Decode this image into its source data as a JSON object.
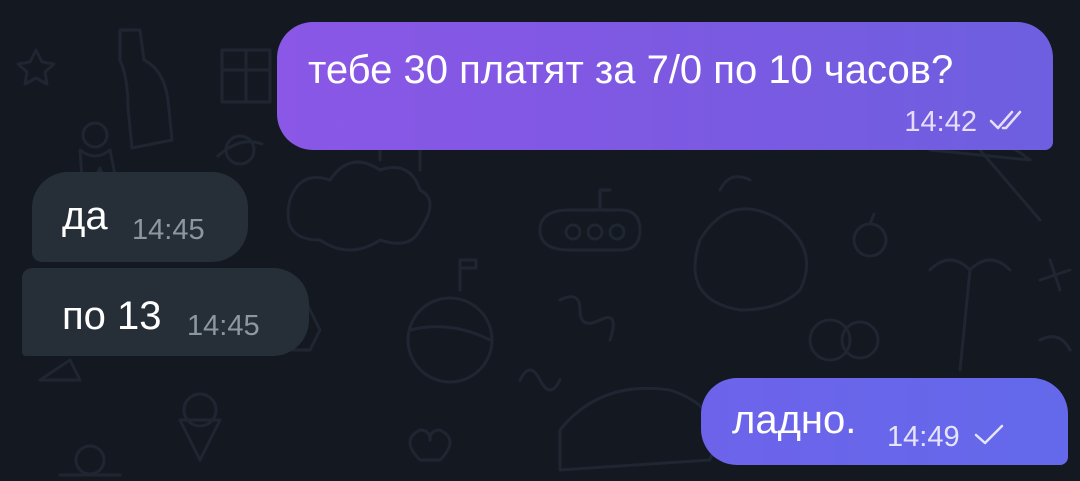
{
  "chat": {
    "background_color": "#141821",
    "messages": [
      {
        "id": "out-1",
        "direction": "outgoing",
        "text": "тебе 30 платят за 7/0 по 10 часов?",
        "time": "14:42",
        "status_icon": "double-check-icon"
      },
      {
        "id": "in-1",
        "direction": "incoming",
        "text": "да",
        "time": "14:45"
      },
      {
        "id": "in-2",
        "direction": "incoming",
        "text": "по 13",
        "time": "14:45"
      },
      {
        "id": "out-2",
        "direction": "outgoing",
        "text": "ладно.",
        "time": "14:49",
        "status_icon": "single-check-icon"
      }
    ]
  },
  "colors": {
    "outgoing_bubble": "#7d59e2",
    "incoming_bubble": "#262f38",
    "incoming_time": "#8d979f"
  }
}
